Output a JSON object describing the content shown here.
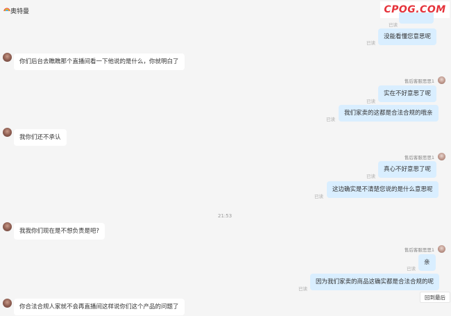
{
  "header": {
    "store_name": "奥特曼"
  },
  "watermark": "CPQG.COM",
  "read_label": "已读",
  "agent_name": "售后客服思思1",
  "time_divider": "21:53",
  "messages": {
    "m0": "没能看懂您意思呢",
    "m1": "你们后台去瞧瞧那个直播间看一下他说的是什么，你就明白了",
    "m2": "实在不好意思了呢",
    "m3": "我们家卖的这都是合法合规的哦亲",
    "m4": "我你们还不承认",
    "m5": "真心不好意思了呢",
    "m6": "这边确实是不清楚您说的是什么意思呢",
    "m7": "我我你们现在是不想负责是吧?",
    "m8": "亲",
    "m9": "因为我们家卖的商品这确实都是合法合规的呢",
    "m10": "你合法合规人家就不会再直播间这样说你们这个产品的问题了"
  },
  "back_to_bottom": "回到最后",
  "colors": {
    "outgoing_bubble": "#d9eeff",
    "incoming_bubble": "#ffffff",
    "watermark": "#e5323a"
  }
}
